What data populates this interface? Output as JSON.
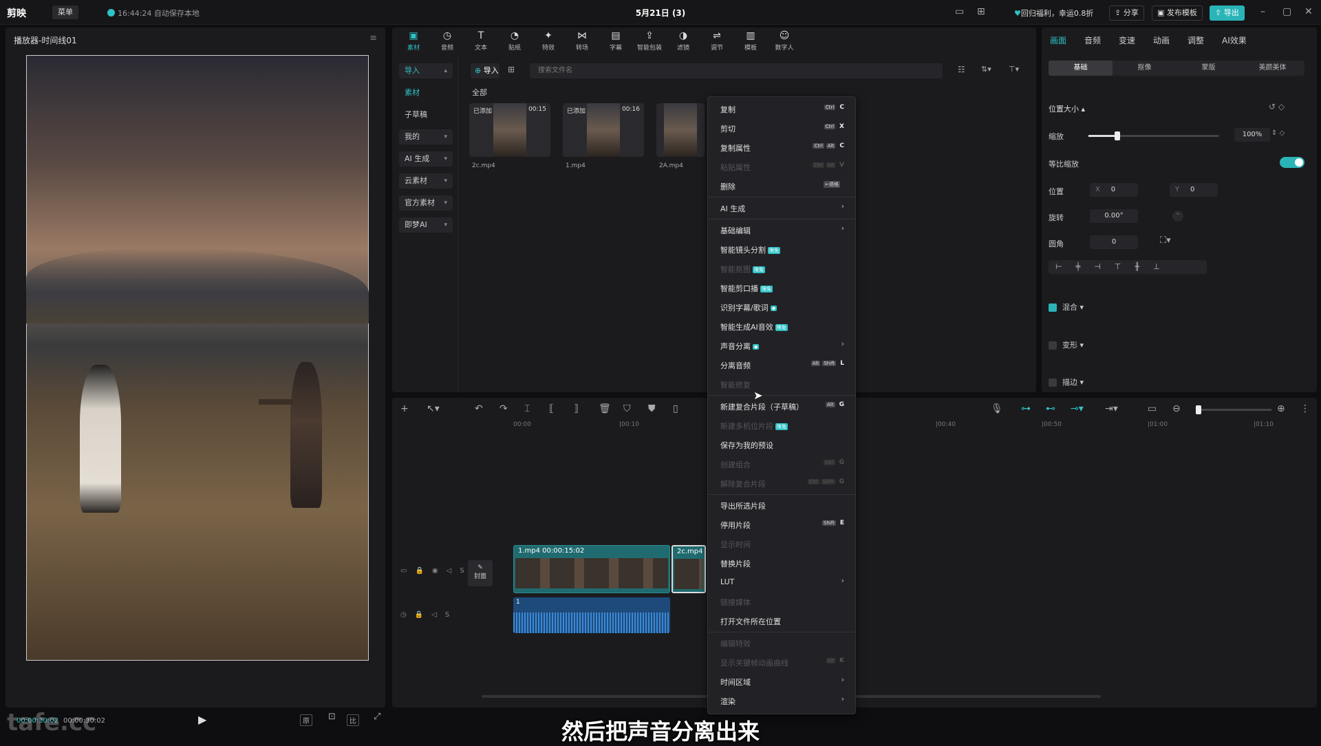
{
  "app": {
    "logo": "剪映",
    "menu": "菜单",
    "autosave": "16:44:24 自动保存本地",
    "title": "5月21日 (3)",
    "promo": "回归福利，幸运0.8折",
    "share": "分享",
    "publish": "发布模板",
    "export": "导出"
  },
  "player": {
    "title": "播放器-时间线01",
    "current": "00:00:30:02",
    "total": "00:00:30:02"
  },
  "media": {
    "tools": [
      {
        "icon": "▣",
        "label": "素材"
      },
      {
        "icon": "◷",
        "label": "音频"
      },
      {
        "icon": "T",
        "label": "文本"
      },
      {
        "icon": "◔",
        "label": "贴纸"
      },
      {
        "icon": "✦",
        "label": "特效"
      },
      {
        "icon": "⋈",
        "label": "转场"
      },
      {
        "icon": "▤",
        "label": "字幕"
      },
      {
        "icon": "⇪",
        "label": "智能包装"
      },
      {
        "icon": "◑",
        "label": "滤镜"
      },
      {
        "icon": "⇌",
        "label": "调节"
      },
      {
        "icon": "▥",
        "label": "模板"
      },
      {
        "icon": "☺",
        "label": "数字人"
      }
    ],
    "nav": [
      "导入",
      "素材",
      "子草稿",
      "我的",
      "AI 生成",
      "云素材",
      "官方素材",
      "即梦AI"
    ],
    "import": "导入",
    "search_placeholder": "搜索文件名",
    "section": "全部",
    "clips": [
      {
        "tag": "已添加",
        "dur": "00:15",
        "name": "2c.mp4"
      },
      {
        "tag": "已添加",
        "dur": "00:16",
        "name": "1.mp4"
      },
      {
        "tag": "",
        "dur": "",
        "name": "2A.mp4"
      }
    ]
  },
  "props": {
    "tabs": [
      "画面",
      "音频",
      "变速",
      "动画",
      "调整",
      "AI效果"
    ],
    "seg": [
      "基础",
      "抠像",
      "蒙版",
      "美颜美体"
    ],
    "section": "位置大小",
    "scale_label": "缩放",
    "scale_value": "100%",
    "ratio_label": "等比缩放",
    "pos_label": "位置",
    "x_label": "X",
    "x_value": "0",
    "y_label": "Y",
    "y_value": "0",
    "rot_label": "旋转",
    "rot_value": "0.00°",
    "corner_label": "圆角",
    "corner_value": "0",
    "blend": "混合",
    "transform": "变形",
    "stroke": "描边",
    "scale_fraction": 0.22
  },
  "timeline": {
    "ticks": [
      "00:00",
      "|00:10",
      "|00:40",
      "|00:50",
      "|01:00",
      "|01:10"
    ],
    "clip1": "1.mp4  00:00:15:02",
    "clip2": "2c.mp4",
    "cover": "封面",
    "audio_num": "1"
  },
  "context_menu": [
    {
      "label": "复制",
      "keys": [
        "Ctrl"
      ],
      "key": "C",
      "dis": false
    },
    {
      "label": "剪切",
      "keys": [
        "Ctrl"
      ],
      "key": "X",
      "dis": false
    },
    {
      "label": "复制属性",
      "keys": [
        "Ctrl",
        "Alt"
      ],
      "key": "C",
      "dis": false
    },
    {
      "label": "粘贴属性",
      "keys": [
        "Ctrl",
        "Alt"
      ],
      "key": "V",
      "dis": true
    },
    {
      "label": "删除",
      "keys": [
        "←退格"
      ],
      "key": "",
      "dis": false,
      "sep": true
    },
    {
      "label": "AI 生成",
      "arrow": true,
      "dis": false,
      "sep": true
    },
    {
      "label": "基础编辑",
      "arrow": true,
      "dis": false
    },
    {
      "label": "智能镜头分割",
      "badge": "限免",
      "dis": false
    },
    {
      "label": "智能抠图",
      "badge": "限免",
      "dis": true
    },
    {
      "label": "智能剪口播",
      "badge": "限免",
      "dis": false
    },
    {
      "label": "识别字幕/歌词",
      "badge": "◆",
      "dis": false
    },
    {
      "label": "智能生成AI音效",
      "badge": "限免",
      "dis": false
    },
    {
      "label": "声音分离",
      "badge": "◆",
      "arrow": true,
      "dis": false
    },
    {
      "label": "分离音频",
      "keys": [
        "Alt",
        "Shift"
      ],
      "key": "L",
      "dis": false
    },
    {
      "label": "智能修复",
      "dis": true,
      "sep": true
    },
    {
      "label": "新建复合片段（子草稿）",
      "keys": [
        "Alt"
      ],
      "key": "G",
      "dis": false
    },
    {
      "label": "新建多机位片段",
      "badge": "限免",
      "dis": true
    },
    {
      "label": "保存为我的预设",
      "dis": false
    },
    {
      "label": "创建组合",
      "keys": [
        "Ctrl"
      ],
      "key": "G",
      "dis": true
    },
    {
      "label": "解除复合片段",
      "keys": [
        "Ctrl",
        "Shift"
      ],
      "key": "G",
      "dis": true,
      "sep": true
    },
    {
      "label": "导出所选片段",
      "dis": false
    },
    {
      "label": "停用片段",
      "keys": [
        "Shift"
      ],
      "key": "E",
      "dis": false
    },
    {
      "label": "显示时间",
      "dis": true
    },
    {
      "label": "替换片段",
      "dis": false
    },
    {
      "label": "LUT",
      "arrow": true,
      "dis": false
    },
    {
      "label": "链接媒体",
      "dis": true
    },
    {
      "label": "打开文件所在位置",
      "dis": false,
      "sep": true
    },
    {
      "label": "编辑特效",
      "dis": true
    },
    {
      "label": "显示关键帧动画曲线",
      "keys": [
        "Alt"
      ],
      "key": "K",
      "dis": true
    },
    {
      "label": "时间区域",
      "arrow": true,
      "dis": false
    },
    {
      "label": "渲染",
      "arrow": true,
      "dis": false
    }
  ],
  "subtitle": "然后把声音分离出来",
  "watermark": "tafe.cc"
}
